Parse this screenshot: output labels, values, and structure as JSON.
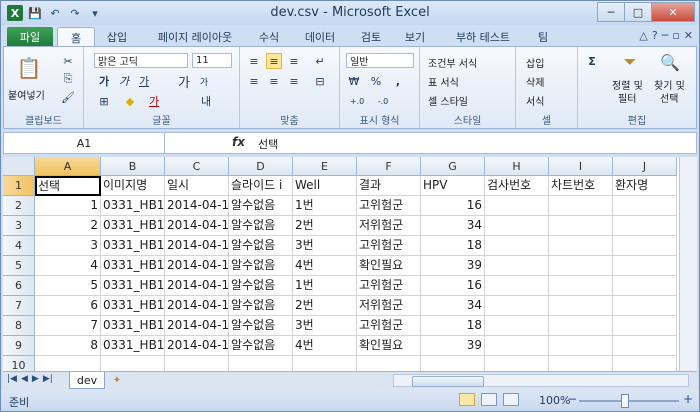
{
  "window": {
    "title": "dev.csv  -  Microsoft Excel",
    "min_label": "─",
    "max_label": "□",
    "close_label": "✕"
  },
  "qat": {
    "logo": "X",
    "save": "💾",
    "undo": "↶",
    "redo": "↷",
    "customize": "▾"
  },
  "tabs": {
    "file": "파일",
    "home": "홈",
    "insert": "삽입",
    "layout": "페이지 레이아웃",
    "formulas": "수식",
    "data": "데이터",
    "review": "검토",
    "view": "보기",
    "load_test": "부하 테스트",
    "team": "팀"
  },
  "ribbon": {
    "clipboard": {
      "label": "클립보드",
      "paste": "붙여넣기",
      "cut": "✂",
      "copy": "⎘",
      "format_painter": "🖌"
    },
    "font": {
      "label": "글꼴",
      "font_name": "맑은 고딕",
      "font_size": "11",
      "bold": "가",
      "italic": "가",
      "underline": "가",
      "grow": "가",
      "shrink": "가",
      "border": "⊞",
      "fill": "◆",
      "color": "가",
      "phonetic": "내"
    },
    "alignment": {
      "label": "맞춤",
      "top": "≡",
      "middle": "≡",
      "bottom": "≡",
      "wrap": "↵",
      "left": "≡",
      "center": "≡",
      "right": "≡",
      "merge": "⊟"
    },
    "number": {
      "label": "표시 형식",
      "format": "일반",
      "currency": "₩",
      "percent": "%",
      "comma": ",",
      "inc": "+.0",
      "dec": "-.0"
    },
    "styles": {
      "label": "스타일",
      "conditional": "조건부 서식",
      "table": "표 서식",
      "cell_style": "셀 스타일"
    },
    "cells": {
      "label": "셀",
      "insert": "삽입",
      "delete": "삭제",
      "format": "서식"
    },
    "editing": {
      "label": "편집",
      "sum": "Σ",
      "sort": "정렬 및",
      "sort2": "필터",
      "find": "찾기 및",
      "find2": "선택"
    }
  },
  "formula_bar": {
    "name_box": "A1",
    "fx": "fx",
    "content": "선택"
  },
  "grid": {
    "columns": [
      "A",
      "B",
      "C",
      "D",
      "E",
      "F",
      "G",
      "H",
      "I",
      "J"
    ],
    "rows": [
      "1",
      "2",
      "3",
      "4",
      "5",
      "6",
      "7",
      "8",
      "9",
      "10"
    ],
    "header": [
      "선택",
      "이미지명",
      "일시",
      "슬라이드 i",
      "Well",
      "결과",
      "HPV",
      "검사번호",
      "차트번호",
      "환자명"
    ],
    "data": [
      [
        "1",
        "0331_HB1(",
        "2014-04-1",
        "알수없음",
        "1번",
        "고위험군",
        "16"
      ],
      [
        "2",
        "0331_HB1(",
        "2014-04-1",
        "알수없음",
        "2번",
        "저위험군",
        "34"
      ],
      [
        "3",
        "0331_HB1(",
        "2014-04-1",
        "알수없음",
        "3번",
        "고위험군",
        "18"
      ],
      [
        "4",
        "0331_HB1(",
        "2014-04-1",
        "알수없음",
        "4번",
        "확인필요",
        "39"
      ],
      [
        "5",
        "0331_HB1(",
        "2014-04-1",
        "알수없음",
        "1번",
        "고위험군",
        "16"
      ],
      [
        "6",
        "0331_HB1(",
        "2014-04-1",
        "알수없음",
        "2번",
        "저위험군",
        "34"
      ],
      [
        "7",
        "0331_HB1(",
        "2014-04-1",
        "알수없음",
        "3번",
        "고위험군",
        "18"
      ],
      [
        "8",
        "0331_HB1(",
        "2014-04-1",
        "알수없음",
        "4번",
        "확인필요",
        "39"
      ]
    ]
  },
  "sheet": {
    "name": "dev",
    "nav": [
      "|◀",
      "◀",
      "▶",
      "▶|"
    ],
    "new_sheet": "✦"
  },
  "status": {
    "ready": "준비",
    "zoom": "100%",
    "minus": "−",
    "plus": "+"
  }
}
